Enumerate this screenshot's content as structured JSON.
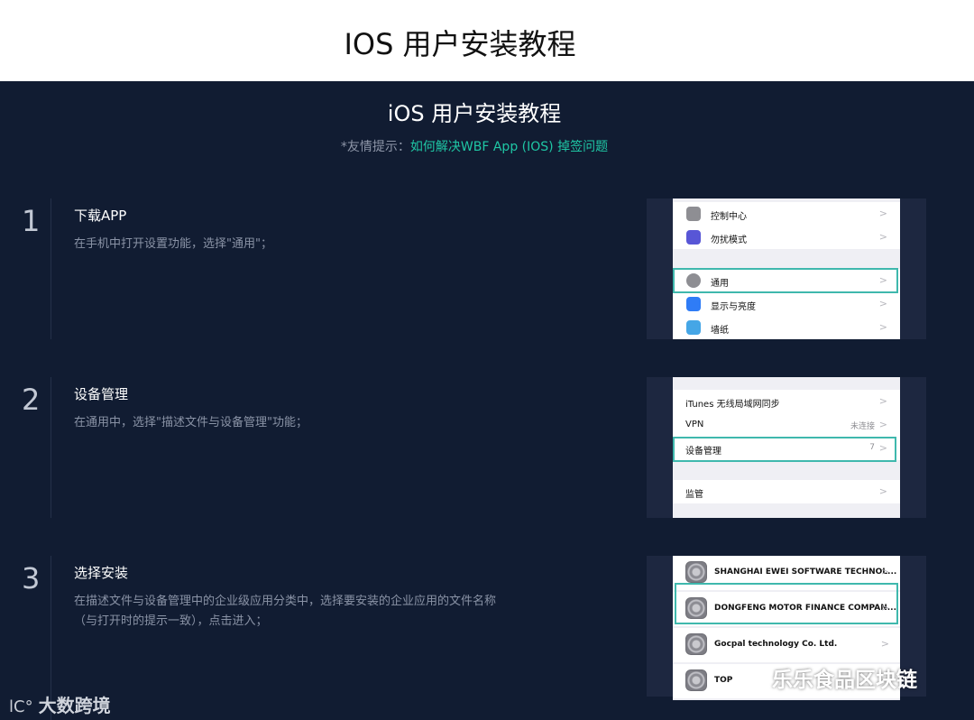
{
  "header": {
    "title": "IOS 用户安装教程"
  },
  "panel": {
    "title": "iOS 用户安装教程",
    "hint_prefix": "*友情提示：",
    "hint_link": "如何解决WBF App (IOS) 掉签问题"
  },
  "steps": [
    {
      "number": "1",
      "title": "下载APP",
      "desc": "在手机中打开设置功能，选择\"通用\"；",
      "rows": [
        "控制中心",
        "勿扰模式",
        "通用",
        "显示与亮度",
        "墙纸"
      ]
    },
    {
      "number": "2",
      "title": "设备管理",
      "desc": "在通用中，选择\"描述文件与设备管理\"功能；",
      "rows": [
        "iTunes 无线局域网同步",
        "VPN",
        "设备管理",
        "监管"
      ],
      "values": {
        "vpn": "未连接",
        "device": "7"
      }
    },
    {
      "number": "3",
      "title": "选择安装",
      "desc": "在描述文件与设备管理中的企业级应用分类中，选择要安装的企业应用的文件名称（与打开时的提示一致），点击进入；",
      "rows": [
        "SHANGHAI EWEI SOFTWARE TECHNOL...",
        "DONGFENG MOTOR FINANCE COMPAN...",
        "Gocpal technology Co. Ltd.",
        "TOP"
      ]
    }
  ],
  "chevron": ">",
  "watermarks": {
    "left_logo": "lC°",
    "left_text": "大数跨境",
    "right_text": "乐乐食品区块链"
  },
  "colors": {
    "panel_bg": "#111c32",
    "accent": "#1fc7a5",
    "highlight": "#3fb8ad"
  }
}
